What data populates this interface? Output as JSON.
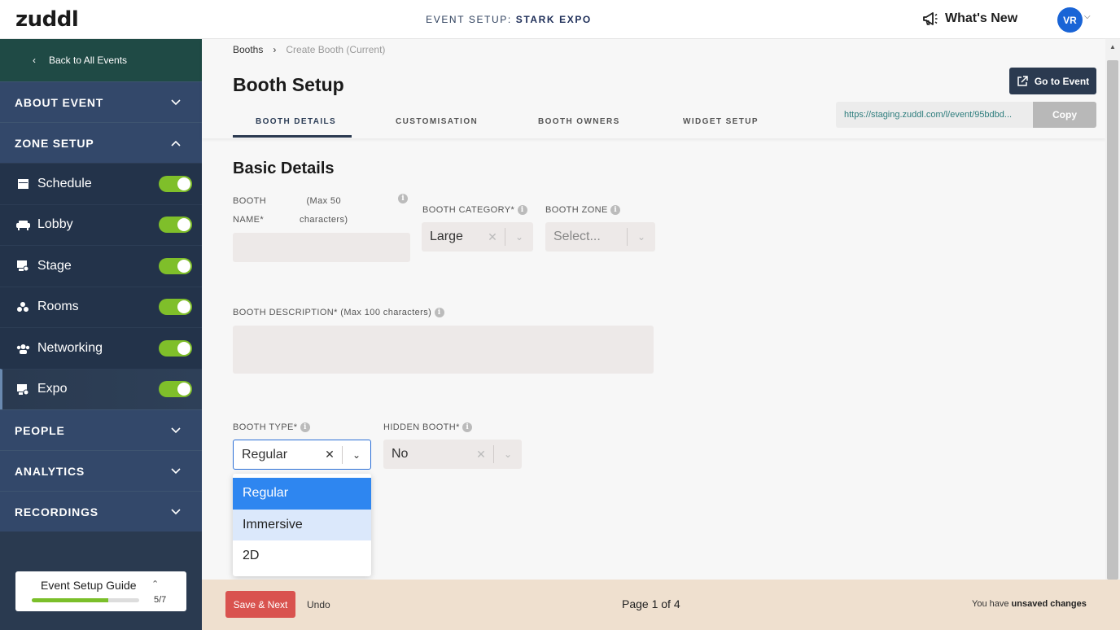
{
  "header": {
    "logo": "zuddl",
    "event_setup_prefix": "EVENT SETUP:",
    "event_name": "STARK EXPO",
    "whats_new": "What's New",
    "avatar_initials": "VR"
  },
  "sidebar": {
    "back": "Back to All Events",
    "sections": {
      "about": "ABOUT EVENT",
      "zone": "ZONE SETUP",
      "people": "PEOPLE",
      "analytics": "ANALYTICS",
      "recordings": "RECORDINGS"
    },
    "zone_items": [
      {
        "label": "Schedule",
        "icon": "calendar-icon",
        "enabled": true
      },
      {
        "label": "Lobby",
        "icon": "sofa-icon",
        "enabled": true
      },
      {
        "label": "Stage",
        "icon": "stage-icon",
        "enabled": true
      },
      {
        "label": "Rooms",
        "icon": "rooms-icon",
        "enabled": true
      },
      {
        "label": "Networking",
        "icon": "networking-icon",
        "enabled": true
      },
      {
        "label": "Expo",
        "icon": "expo-icon",
        "enabled": true
      }
    ],
    "guide": {
      "title": "Event Setup Guide",
      "count": "5/7",
      "progress": 0.714
    }
  },
  "breadcrumb": {
    "parent": "Booths",
    "current": "Create Booth (Current)"
  },
  "page_title": "Booth Setup",
  "go_to_event": "Go to Event",
  "event_url": "https://staging.zuddl.com/l/event/95bdbd...",
  "copy_label": "Copy",
  "tabs": [
    "BOOTH DETAILS",
    "CUSTOMISATION",
    "BOOTH OWNERS",
    "WIDGET SETUP"
  ],
  "form": {
    "section_title": "Basic Details",
    "booth_name_label_a": "BOOTH",
    "booth_name_label_b": "NAME*",
    "booth_name_hint_a": "(Max 50",
    "booth_name_hint_b": "characters)",
    "booth_category_label": "BOOTH CATEGORY*",
    "booth_category_value": "Large",
    "booth_zone_label": "BOOTH ZONE",
    "booth_zone_placeholder": "Select...",
    "description_label": "BOOTH DESCRIPTION* (Max 100 characters)",
    "booth_type_label": "BOOTH TYPE*",
    "booth_type_value": "Regular",
    "hidden_booth_label": "HIDDEN BOOTH*",
    "hidden_booth_value": "No",
    "booth_type_options": [
      "Regular",
      "Immersive",
      "2D"
    ]
  },
  "footer": {
    "save": "Save & Next",
    "undo": "Undo",
    "page": "Page 1 of 4",
    "unsaved_prefix": "You have",
    "unsaved_bold": "unsaved changes"
  },
  "colors": {
    "accent": "#2b3a50",
    "toggle_on": "#7fbf2a",
    "save": "#d9534f",
    "option_selected": "#2e86f0"
  }
}
